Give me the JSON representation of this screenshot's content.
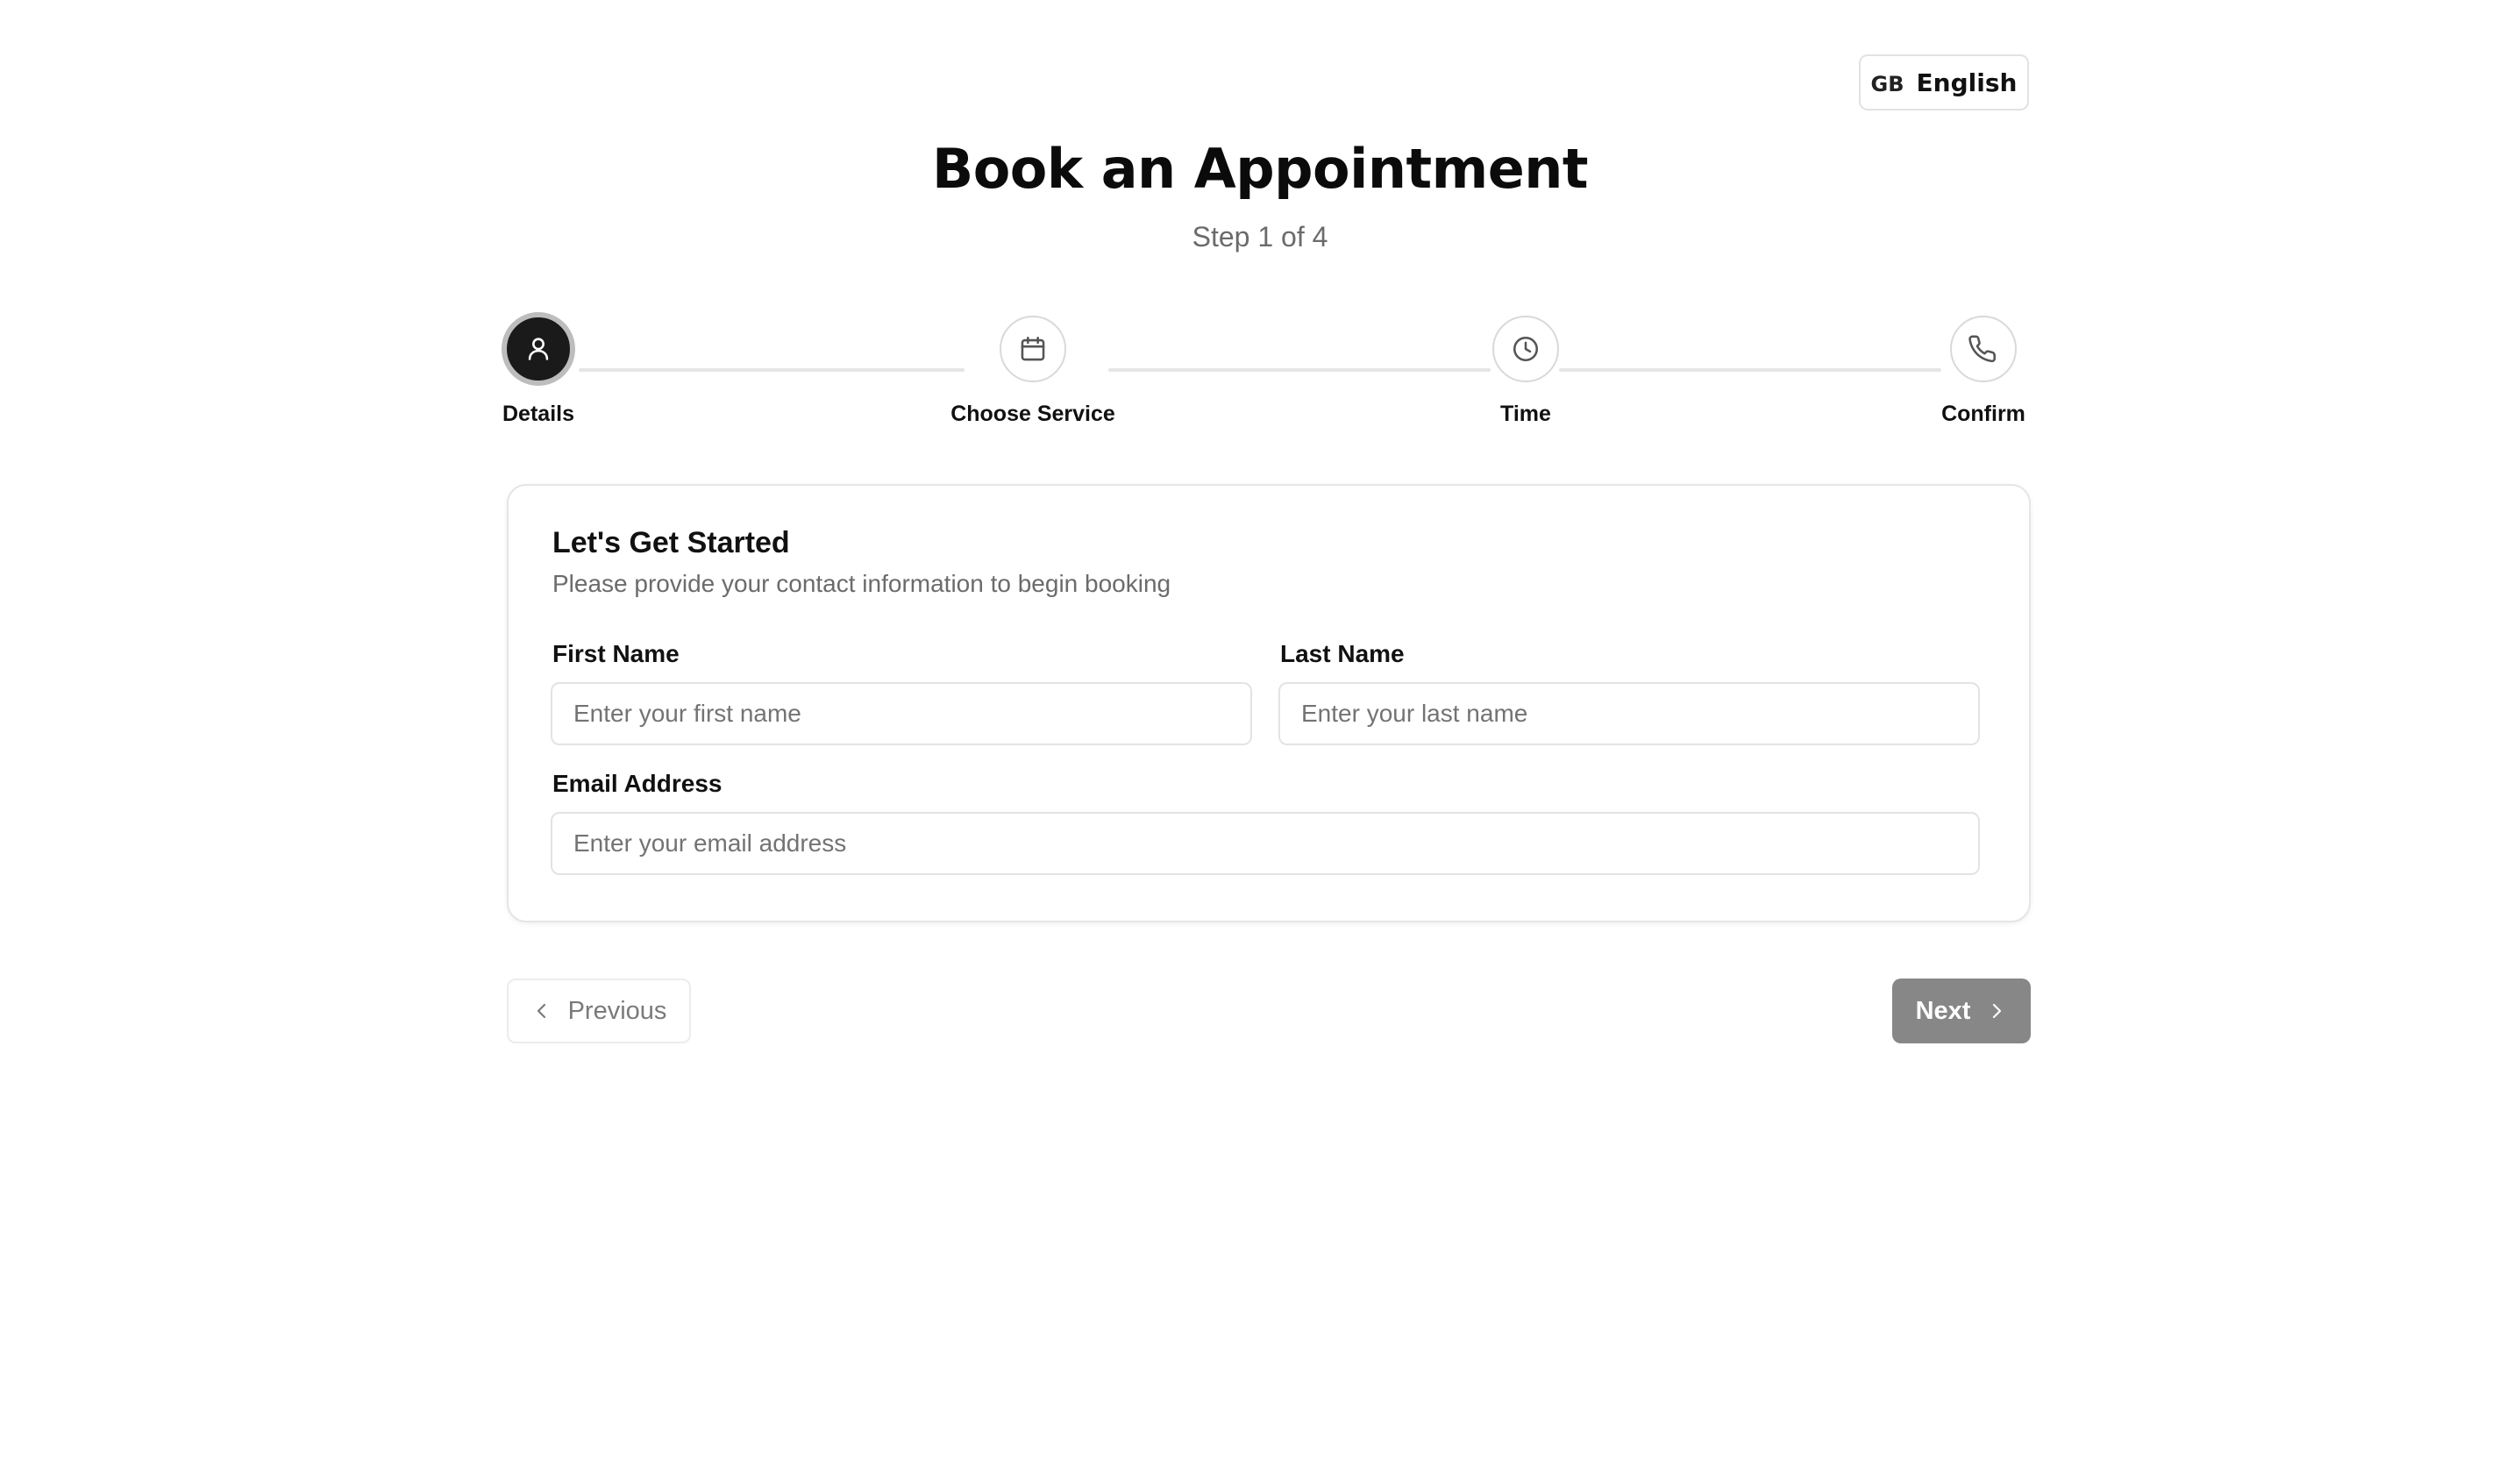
{
  "language": {
    "flag": "GB",
    "label": "English"
  },
  "header": {
    "title": "Book an Appointment",
    "subtitle": "Step 1 of 4"
  },
  "steps": [
    {
      "label": "Details",
      "icon": "user-icon",
      "active": true
    },
    {
      "label": "Choose Service",
      "icon": "calendar-icon",
      "active": false
    },
    {
      "label": "Time",
      "icon": "clock-icon",
      "active": false
    },
    {
      "label": "Confirm",
      "icon": "phone-icon",
      "active": false
    }
  ],
  "form": {
    "title": "Let's Get Started",
    "description": "Please provide your contact information to begin booking",
    "first_name": {
      "label": "First Name",
      "value": "",
      "placeholder": "Enter your first name"
    },
    "last_name": {
      "label": "Last Name",
      "value": "",
      "placeholder": "Enter your last name"
    },
    "email": {
      "label": "Email Address",
      "value": "",
      "placeholder": "Enter your email address"
    }
  },
  "nav": {
    "previous_label": "Previous",
    "next_label": "Next"
  },
  "colors": {
    "active_step": "#1a1a1a",
    "next_button": "#878787",
    "muted_text": "#6b6b6b"
  }
}
